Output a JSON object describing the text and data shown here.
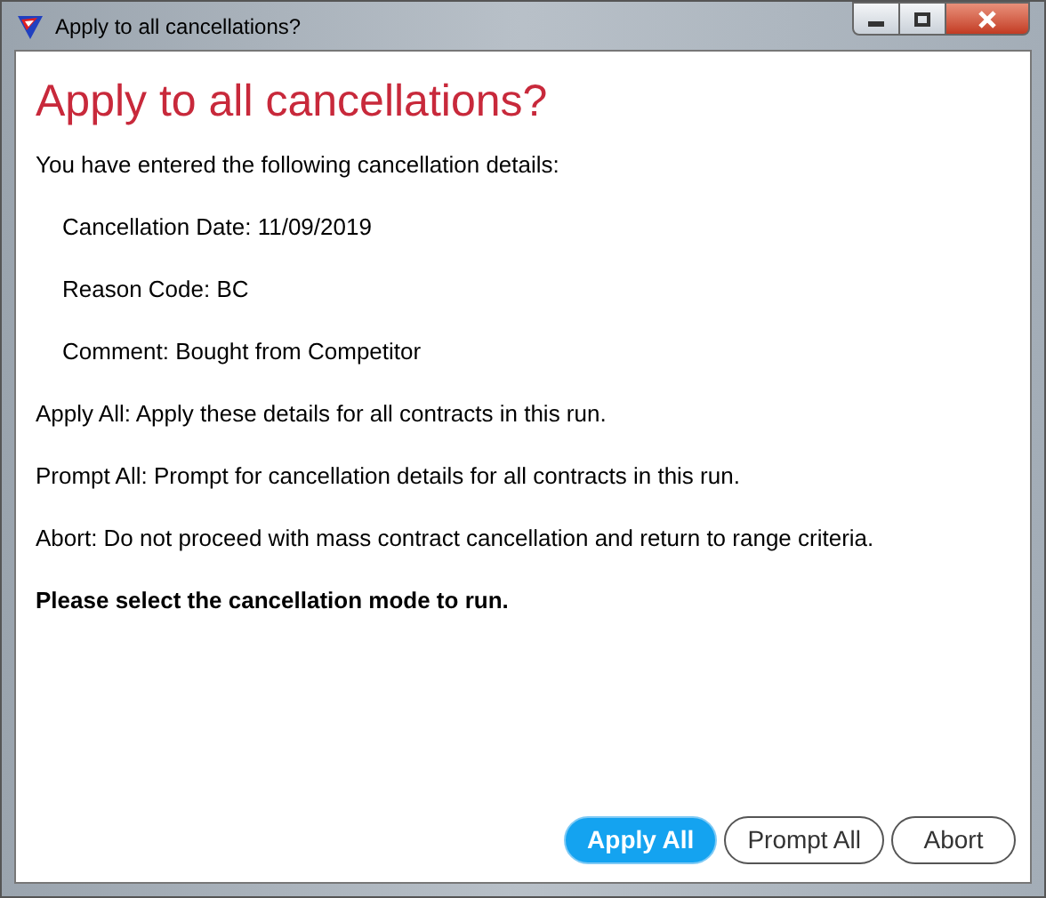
{
  "window": {
    "title": "Apply to all cancellations?"
  },
  "heading": "Apply to all cancellations?",
  "paragraphs": [
    {
      "kind": "plain",
      "text": "You have entered the following cancellation details:"
    },
    {
      "kind": "indented",
      "text": "Cancellation Date: 11/09/2019"
    },
    {
      "kind": "indented",
      "text": "Reason Code: BC"
    },
    {
      "kind": "indented",
      "text": "Comment: Bought from Competitor"
    },
    {
      "kind": "plain",
      "text": "Apply All: Apply these details for all contracts in this run."
    },
    {
      "kind": "plain",
      "text": "Prompt All: Prompt for cancellation details for all contracts in this run."
    },
    {
      "kind": "plain",
      "text": "Abort: Do not proceed with mass contract cancellation and return to range criteria."
    },
    {
      "kind": "bold",
      "text": "Please select the cancellation mode to run."
    }
  ],
  "buttons": [
    {
      "label": "Apply All",
      "selected": true
    },
    {
      "label": "Prompt All",
      "selected": false
    },
    {
      "label": "Abort",
      "selected": false
    }
  ]
}
